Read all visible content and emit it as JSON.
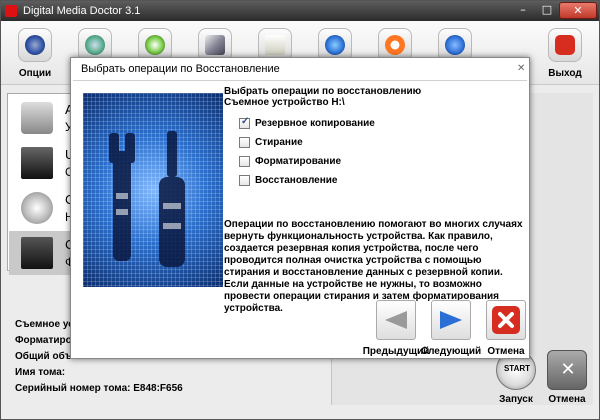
{
  "window": {
    "title": "Digital Media Doctor 3.1"
  },
  "toolbar": {
    "items": [
      {
        "label": "Опции",
        "icon": "gear-icon"
      },
      {
        "label": "",
        "icon": "stethoscope-icon"
      },
      {
        "label": "",
        "icon": "gauge-icon"
      },
      {
        "label": "",
        "icon": "wrench-icon"
      },
      {
        "label": "",
        "icon": "clipboard-icon"
      },
      {
        "label": "",
        "icon": "refresh-icon"
      },
      {
        "label": "",
        "icon": "lifebuoy-icon"
      },
      {
        "label": "",
        "icon": "info-icon"
      },
      {
        "label": "Выход",
        "icon": "exit-icon"
      }
    ]
  },
  "devices": [
    {
      "name": "А",
      "sub": "У"
    },
    {
      "name": "U",
      "sub": "О"
    },
    {
      "name": "С",
      "sub": "Н"
    },
    {
      "name": "С",
      "sub": "Ф"
    }
  ],
  "info": {
    "removable": "Съемное устр",
    "format": "Форматирова",
    "total": "Общий объем",
    "volume_name": "Имя тома:",
    "serial": "Серийный номер тома: E848:F656"
  },
  "actions": {
    "start": "Запуск",
    "start_icon_text": "START",
    "cancel": "Отмена"
  },
  "dialog": {
    "title": "Выбрать операции по Восстановление",
    "heading": "Выбрать операции по восстановлению",
    "device": "Съемное устройство H:\\",
    "options": [
      {
        "label": "Резервное копирование",
        "checked": true
      },
      {
        "label": "Стирание",
        "checked": false
      },
      {
        "label": "Форматирование",
        "checked": false
      },
      {
        "label": "Восстановление",
        "checked": false
      }
    ],
    "checkmark": "✓",
    "description": "Операции по восстановлению помогают во многих случаях вернуть функциональность устройства. Как правило, создается резервная копия устройства, после чего проводится полная очистка устройства с помощью стирания и восстановление данных с резервной копии. Если данные на устройстве не нужны, то возможно провести операции стирания и затем форматирования устройства.",
    "buttons": {
      "prev": "Предыдущий",
      "next": "Следующий",
      "cancel": "Отмена"
    }
  },
  "colors": {
    "accent_blue": "#2b6fd6",
    "exit_red": "#d62d20"
  }
}
